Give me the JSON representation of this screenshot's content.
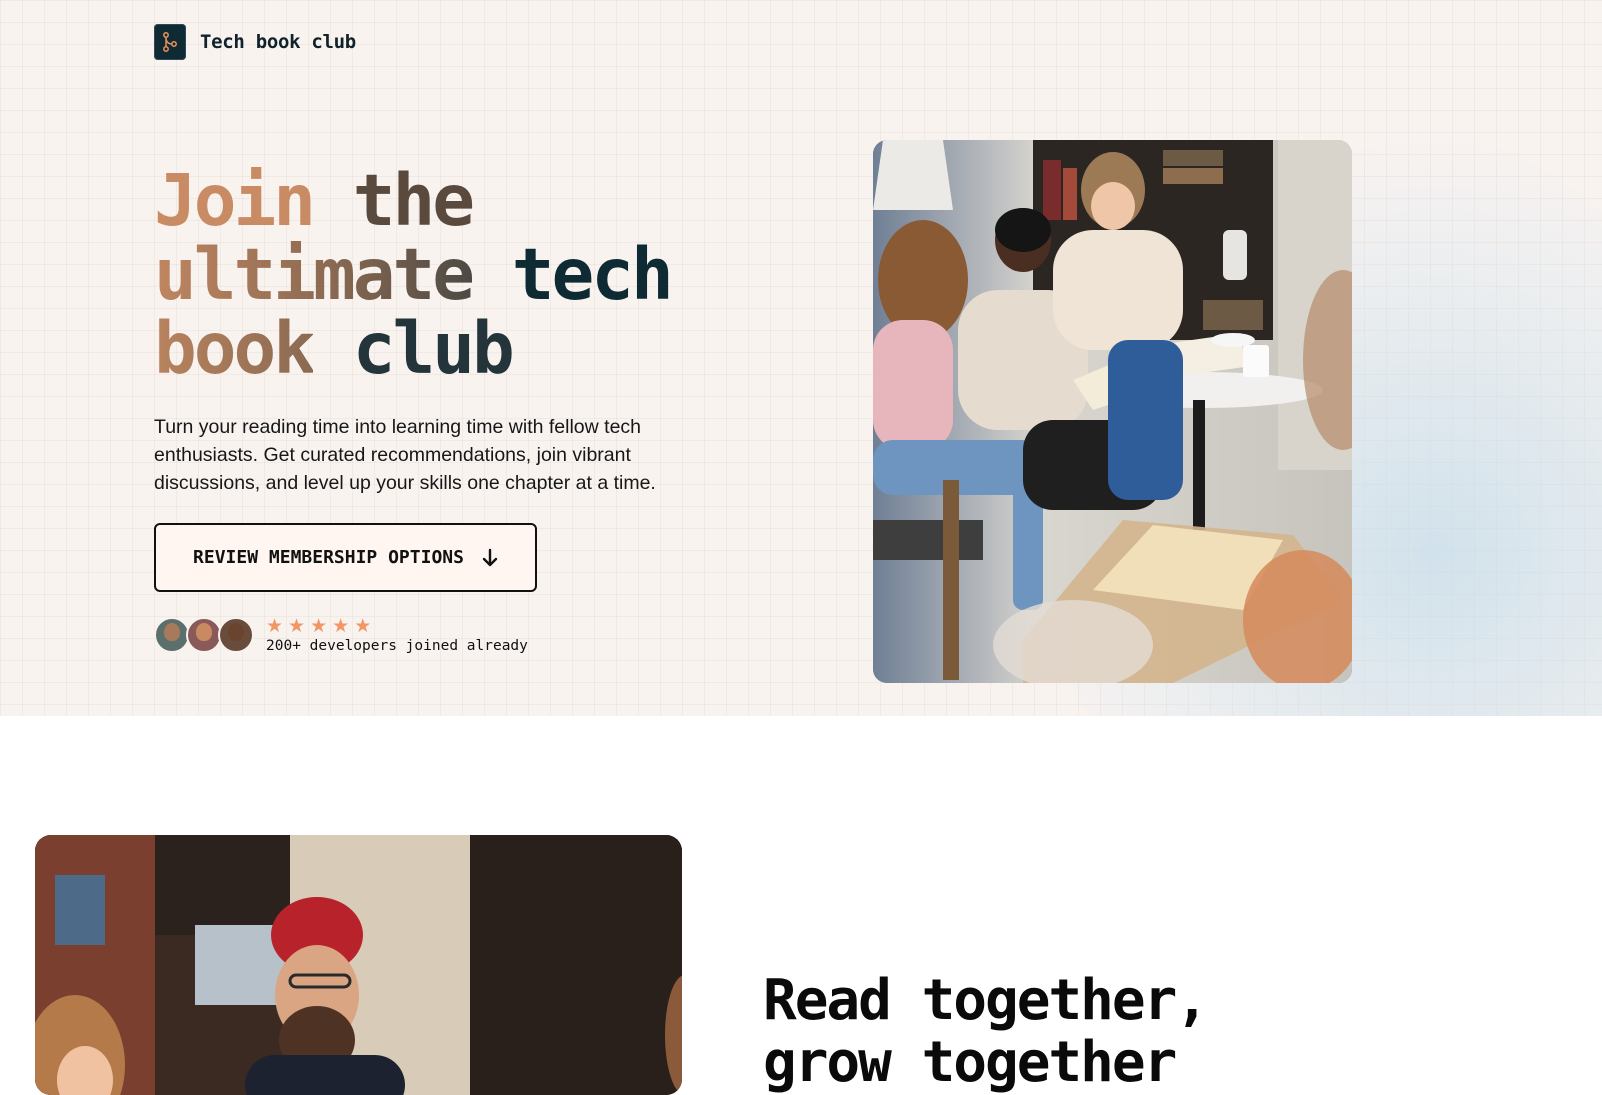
{
  "brand": {
    "name": "Tech book club",
    "logo_icon": "branch-icon"
  },
  "hero": {
    "headline": {
      "line1": {
        "word1": "Join",
        "word2": "the"
      },
      "line2": {
        "word1": "ultimate",
        "word2": "tech"
      },
      "line3": {
        "word1": "book",
        "word2": "club"
      }
    },
    "subtext": "Turn your reading time into learning time with fellow tech enthusiasts. Get curated recommendations, join vibrant discussions, and level up your skills one chapter at a time.",
    "cta_label": "REVIEW MEMBERSHIP OPTIONS",
    "cta_icon": "arrow-down-icon",
    "rating_stars": 5,
    "social_proof": "200+ developers joined already",
    "photo_icon": "group-reading-photo"
  },
  "section2": {
    "title_line1": "Read together,",
    "title_line2": "grow together",
    "photo_icon": "people-in-cafe-photo"
  },
  "colors": {
    "hero_bg": "#f9f3f0",
    "accent_copper": "#c98b64",
    "dark_teal": "#0f2a33",
    "star": "#f19766",
    "cta_bg": "#fff6f1"
  }
}
